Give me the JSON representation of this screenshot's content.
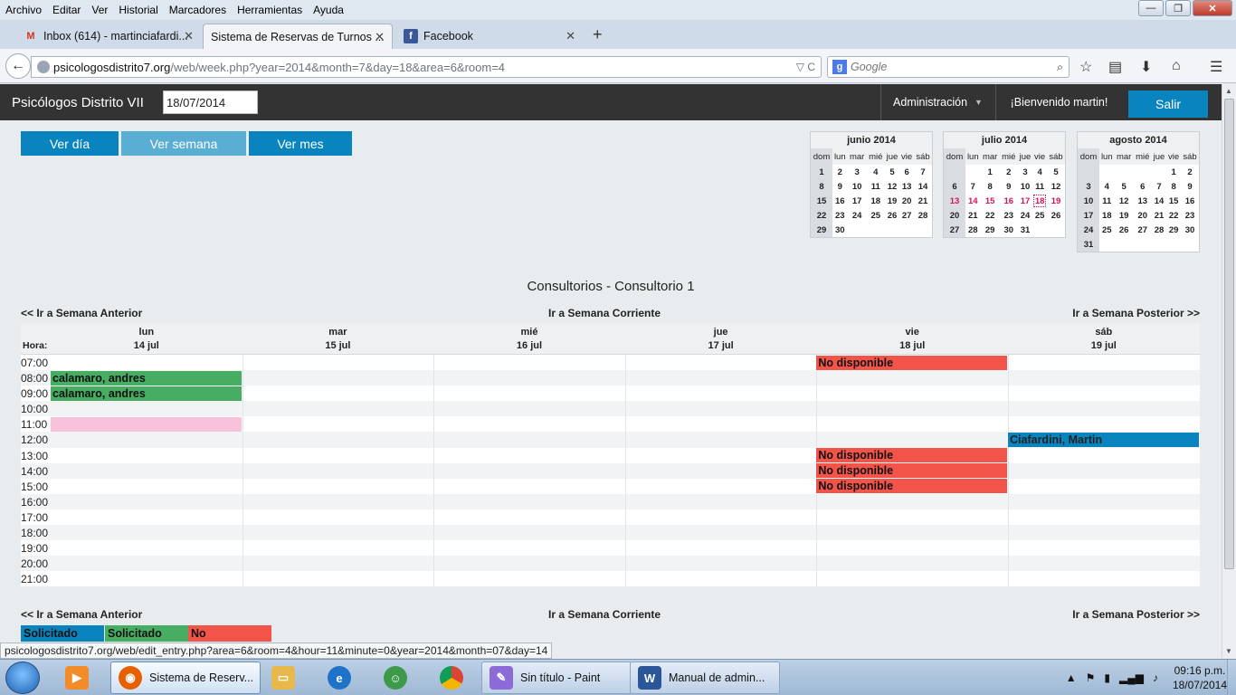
{
  "browser": {
    "menu": [
      "Archivo",
      "Editar",
      "Ver",
      "Historial",
      "Marcadores",
      "Herramientas",
      "Ayuda"
    ],
    "window_controls": {
      "minimize": "—",
      "restore": "❐",
      "close": "✕"
    },
    "tabs": [
      {
        "label": "Inbox (614) - martinciafardi...",
        "icon": "gmail-icon",
        "active": false
      },
      {
        "label": "Sistema de Reservas de Turnos ...",
        "icon": "",
        "active": true
      },
      {
        "label": "Facebook",
        "icon": "facebook-icon",
        "active": false
      }
    ],
    "new_tab_symbol": "+",
    "url_host": "psicologosdistrito7.org",
    "url_path": "/web/week.php?year=2014&month=7&day=18&area=6&room=4",
    "url_actions": "▽  C",
    "search_engine": "g",
    "search_placeholder": "Google",
    "status_url": "psicologosdistrito7.org/web/edit_entry.php?area=6&room=4&hour=11&minute=0&year=2014&month=07&day=14"
  },
  "header": {
    "site_title": "Psicólogos Distrito VII",
    "date_value": "18/07/2014",
    "admin_menu": "Administración",
    "welcome": "¡Bienvenido martin!",
    "logout": "Salir"
  },
  "view_buttons": {
    "day": "Ver día",
    "week": "Ver semana",
    "month": "Ver mes"
  },
  "mini_calendars": [
    {
      "title": "junio 2014",
      "weekdays": [
        "dom",
        "lun",
        "mar",
        "mié",
        "jue",
        "vie",
        "sáb"
      ],
      "weeks": [
        [
          "1",
          "2",
          "3",
          "4",
          "5",
          "6",
          "7"
        ],
        [
          "8",
          "9",
          "10",
          "11",
          "12",
          "13",
          "14"
        ],
        [
          "15",
          "16",
          "17",
          "18",
          "19",
          "20",
          "21"
        ],
        [
          "22",
          "23",
          "24",
          "25",
          "26",
          "27",
          "28"
        ],
        [
          "29",
          "30",
          "",
          "",
          "",
          "",
          ""
        ]
      ],
      "highlight": [],
      "today": ""
    },
    {
      "title": "julio 2014",
      "weekdays": [
        "dom",
        "lun",
        "mar",
        "mié",
        "jue",
        "vie",
        "sáb"
      ],
      "weeks": [
        [
          "",
          "",
          "1",
          "2",
          "3",
          "4",
          "5"
        ],
        [
          "6",
          "7",
          "8",
          "9",
          "10",
          "11",
          "12"
        ],
        [
          "13",
          "14",
          "15",
          "16",
          "17",
          "18",
          "19"
        ],
        [
          "20",
          "21",
          "22",
          "23",
          "24",
          "25",
          "26"
        ],
        [
          "27",
          "28",
          "29",
          "30",
          "31",
          "",
          ""
        ]
      ],
      "highlight": [
        "13",
        "14",
        "15",
        "16",
        "17",
        "18",
        "19"
      ],
      "today": "18"
    },
    {
      "title": "agosto 2014",
      "weekdays": [
        "dom",
        "lun",
        "mar",
        "mié",
        "jue",
        "vie",
        "sáb"
      ],
      "weeks": [
        [
          "",
          "",
          "",
          "",
          "",
          "1",
          "2"
        ],
        [
          "3",
          "4",
          "5",
          "6",
          "7",
          "8",
          "9"
        ],
        [
          "10",
          "11",
          "12",
          "13",
          "14",
          "15",
          "16"
        ],
        [
          "17",
          "18",
          "19",
          "20",
          "21",
          "22",
          "23"
        ],
        [
          "24",
          "25",
          "26",
          "27",
          "28",
          "29",
          "30"
        ],
        [
          "31",
          "",
          "",
          "",
          "",
          "",
          ""
        ]
      ],
      "highlight": [],
      "today": ""
    }
  ],
  "room_title": "Consultorios - Consultorio 1",
  "nav": {
    "prev": "<< Ir a Semana Anterior",
    "current": "Ir a Semana Corriente",
    "next": "Ir a Semana Posterior >>"
  },
  "week": {
    "hora_label": "Hora:",
    "days": [
      {
        "name": "lun",
        "date": "14 jul"
      },
      {
        "name": "mar",
        "date": "15 jul"
      },
      {
        "name": "mié",
        "date": "16 jul"
      },
      {
        "name": "jue",
        "date": "17 jul"
      },
      {
        "name": "vie",
        "date": "18 jul"
      },
      {
        "name": "sáb",
        "date": "19 jul"
      }
    ],
    "hours": [
      "07:00",
      "08:00",
      "09:00",
      "10:00",
      "11:00",
      "12:00",
      "13:00",
      "14:00",
      "15:00",
      "16:00",
      "17:00",
      "18:00",
      "19:00",
      "20:00",
      "21:00"
    ],
    "selected_hour": "11:00",
    "bookings": [
      {
        "day": 4,
        "hour": 0,
        "text": "No disponible",
        "color": "red"
      },
      {
        "day": 0,
        "hour": 1,
        "text": "calamaro, andres",
        "color": "green"
      },
      {
        "day": 0,
        "hour": 2,
        "text": "calamaro, andres",
        "color": "green"
      },
      {
        "day": 0,
        "hour": 4,
        "text": "",
        "color": "pink"
      },
      {
        "day": 5,
        "hour": 5,
        "text": "Ciafardini, Martin",
        "color": "blue"
      },
      {
        "day": 4,
        "hour": 6,
        "text": "No disponible",
        "color": "red"
      },
      {
        "day": 4,
        "hour": 7,
        "text": "No disponible",
        "color": "red"
      },
      {
        "day": 4,
        "hour": 8,
        "text": "No disponible",
        "color": "red"
      }
    ]
  },
  "legend": [
    {
      "label": "Solicitado",
      "color": "#0a84be"
    },
    {
      "label": "Solicitado",
      "color": "#47ad63"
    },
    {
      "label": "No",
      "color": "#f2544a"
    }
  ],
  "taskbar": {
    "pinned": [
      "media-player-icon",
      "explorer-icon",
      "internet-explorer-icon",
      "users-icon",
      "chrome-icon"
    ],
    "windows": [
      {
        "label": "Sistema de Reserv...",
        "icon": "firefox-icon",
        "active": true
      },
      {
        "label": "Sin título - Paint",
        "icon": "paint-icon",
        "active": false
      },
      {
        "label": "Manual de admin...",
        "icon": "word-icon",
        "active": false
      }
    ],
    "time": "09:16 p.m.",
    "date": "18/07/2014"
  }
}
